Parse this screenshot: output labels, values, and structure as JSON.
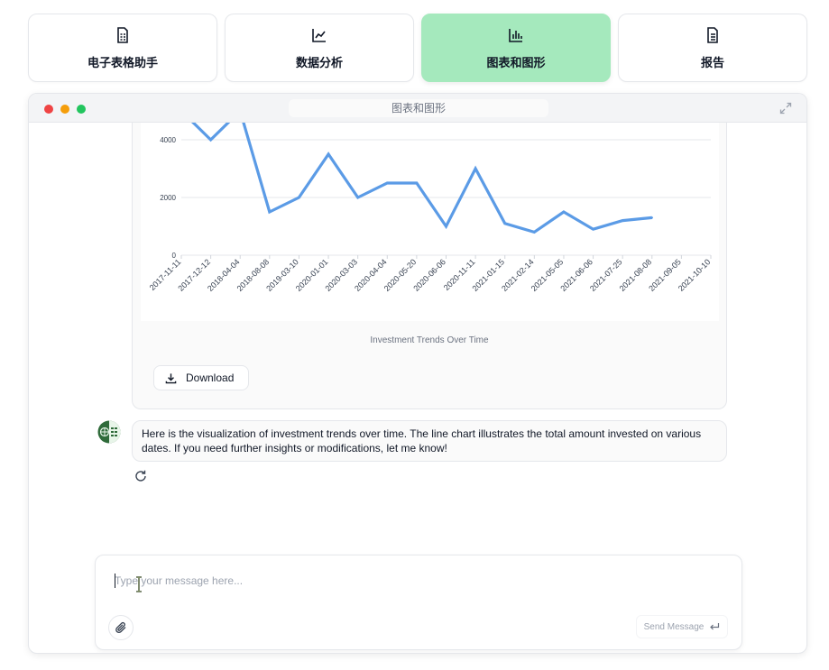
{
  "tabs": [
    {
      "label": "电子表格助手",
      "icon": "spreadsheet-icon"
    },
    {
      "label": "数据分析",
      "icon": "line-chart-icon"
    },
    {
      "label": "图表和图形",
      "icon": "bar-chart-icon",
      "active": true
    },
    {
      "label": "报告",
      "icon": "document-icon"
    }
  ],
  "window": {
    "title": "图表和图形"
  },
  "chart_card": {
    "caption": "Investment Trends Over Time",
    "download_label": "Download"
  },
  "chart_data": {
    "type": "line",
    "title": "",
    "xlabel": "",
    "ylabel": "",
    "ylim": [
      0,
      5000
    ],
    "yticks": [
      "0",
      "2000",
      "4000"
    ],
    "grid": true,
    "series_color": "#5b9be6",
    "x": [
      "2017-11-11",
      "2017-12-12",
      "2018-04-04",
      "2018-08-08",
      "2019-03-10",
      "2020-01-01",
      "2020-03-03",
      "2020-04-04",
      "2020-05-20",
      "2020-06-06",
      "2020-11-11",
      "2021-01-15",
      "2021-02-14",
      "2021-05-05",
      "2021-06-06",
      "2021-07-25",
      "2021-08-08",
      "2021-09-05",
      "2021-10-10"
    ],
    "values": [
      5000,
      4000,
      5000,
      1500,
      2000,
      3500,
      2000,
      2500,
      2500,
      1000,
      3000,
      1100,
      800,
      1500,
      900,
      1200,
      1300,
      null,
      null
    ]
  },
  "assistant_message": {
    "text": "Here is the visualization of investment trends over time. The line chart illustrates the total amount invested on various dates. If you need further insights or modifications, let me know!"
  },
  "composer": {
    "placeholder": "Type your message here...",
    "send_label": "Send Message"
  },
  "colors": {
    "active_tab": "#a5e9bd",
    "line": "#5b9be6",
    "close": "#ef4444",
    "minimize": "#f59e0b",
    "maximize": "#22c55e"
  }
}
